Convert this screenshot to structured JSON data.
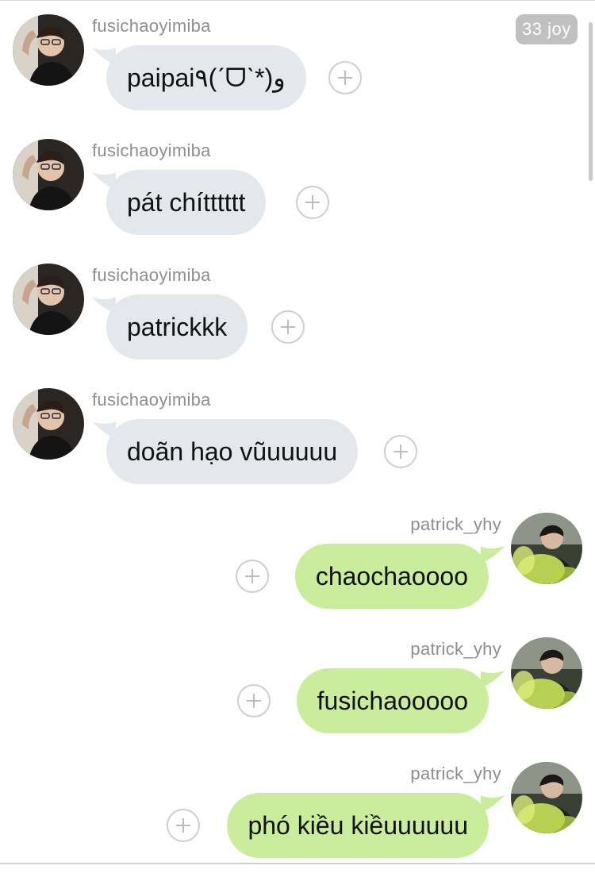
{
  "badge": {
    "label": "33 joy"
  },
  "messages": [
    {
      "side": "left",
      "username": "fusichaoyimiba",
      "text": "paipai٩(ˊᗜˋ*)و",
      "avatar": "avatar-fusichaoyimiba"
    },
    {
      "side": "left",
      "username": "fusichaoyimiba",
      "text": "pát chítttttt",
      "avatar": "avatar-fusichaoyimiba"
    },
    {
      "side": "left",
      "username": "fusichaoyimiba",
      "text": "patrickkk",
      "avatar": "avatar-fusichaoyimiba"
    },
    {
      "side": "left",
      "username": "fusichaoyimiba",
      "text": "doãn hạo vũuuuuu",
      "avatar": "avatar-fusichaoyimiba"
    },
    {
      "side": "right",
      "username": "patrick_yhy",
      "text": "chaochaoooo",
      "avatar": "avatar-patrick_yhy"
    },
    {
      "side": "right",
      "username": "patrick_yhy",
      "text": "fusichaooooo",
      "avatar": "avatar-patrick_yhy"
    },
    {
      "side": "right",
      "username": "patrick_yhy",
      "text": "phó kiều kiềuuuuuu",
      "avatar": "avatar-patrick_yhy"
    }
  ],
  "icons": {
    "add_reaction": "plus-circle-icon"
  },
  "colors": {
    "left_bubble": "#e4e7ec",
    "right_bubble": "#c9ed9c",
    "badge": "#c0c0c0",
    "username": "#8e8e8e"
  }
}
